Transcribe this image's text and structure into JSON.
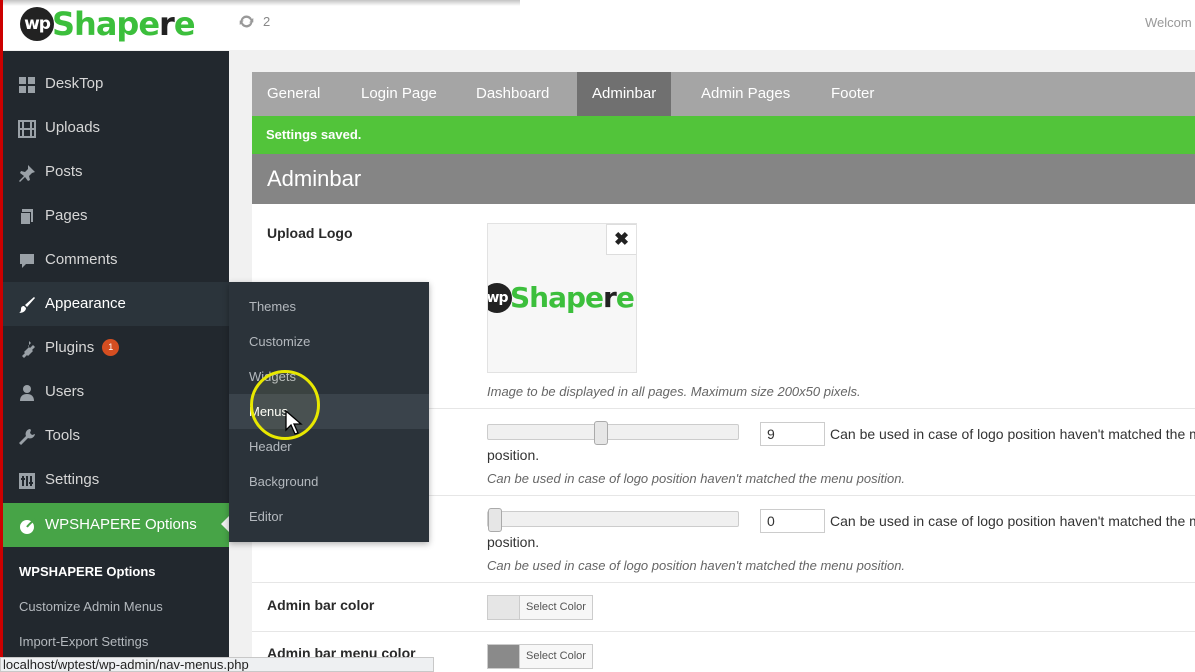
{
  "topbar": {
    "logo_prefix": "wp",
    "logo_part1": "Shap",
    "logo_part2": "e",
    "logo_part3": "r",
    "logo_part4": "e",
    "updates_count": "2",
    "welcome_text": "Welcom"
  },
  "sidebar": {
    "items": [
      {
        "label": "DeskTop",
        "icon": "dashboard-icon"
      },
      {
        "label": "Uploads",
        "icon": "film-icon"
      },
      {
        "label": "Posts",
        "icon": "pin-icon"
      },
      {
        "label": "Pages",
        "icon": "pages-icon"
      },
      {
        "label": "Comments",
        "icon": "comment-icon"
      },
      {
        "label": "Appearance",
        "icon": "brush-icon"
      },
      {
        "label": "Plugins",
        "icon": "plug-icon",
        "badge": "1"
      },
      {
        "label": "Users",
        "icon": "user-icon"
      },
      {
        "label": "Tools",
        "icon": "wrench-icon"
      },
      {
        "label": "Settings",
        "icon": "sliders-icon"
      },
      {
        "label": "WPSHAPERE Options",
        "icon": "leaf-icon"
      }
    ],
    "submenu": [
      {
        "label": "WPSHAPERE Options"
      },
      {
        "label": "Customize Admin Menus"
      },
      {
        "label": "Import-Export Settings"
      }
    ]
  },
  "flyout": {
    "items": [
      {
        "label": "Themes"
      },
      {
        "label": "Customize"
      },
      {
        "label": "Widgets"
      },
      {
        "label": "Menus"
      },
      {
        "label": "Header"
      },
      {
        "label": "Background"
      },
      {
        "label": "Editor"
      }
    ]
  },
  "tabs": [
    {
      "label": "General"
    },
    {
      "label": "Login Page"
    },
    {
      "label": "Dashboard"
    },
    {
      "label": "Adminbar"
    },
    {
      "label": "Admin Pages"
    },
    {
      "label": "Footer"
    }
  ],
  "notice": "Settings saved.",
  "section_title": "Adminbar",
  "upload_logo": {
    "label": "Upload Logo",
    "remove_symbol": "✖",
    "description": "Image to be displayed in all pages. Maximum size 200x50 pixels."
  },
  "slider1": {
    "value": "9",
    "fraction": 0.45,
    "help": "Can be used in case of logo position haven't matched the menu",
    "help_cont": "position.",
    "description": "Can be used in case of logo position haven't matched the menu position."
  },
  "slider2": {
    "value": "0",
    "fraction": 0,
    "help": "Can be used in case of logo position haven't matched the menu",
    "help_cont": "position.",
    "description": "Can be used in case of logo position haven't matched the menu position."
  },
  "admin_bar_color": {
    "label": "Admin bar color",
    "button": "Select Color",
    "swatch": "#e6e6e6"
  },
  "admin_bar_menu_color": {
    "label": "Admin bar menu color",
    "button": "Select Color",
    "swatch": "#8a8a8a"
  },
  "statusbar": "localhost/wptest/wp-admin/nav-menus.php",
  "colors": {
    "accent_green": "#52c43a",
    "sidebar_bg": "#22282e",
    "tab_bar": "#a5a5a5"
  }
}
